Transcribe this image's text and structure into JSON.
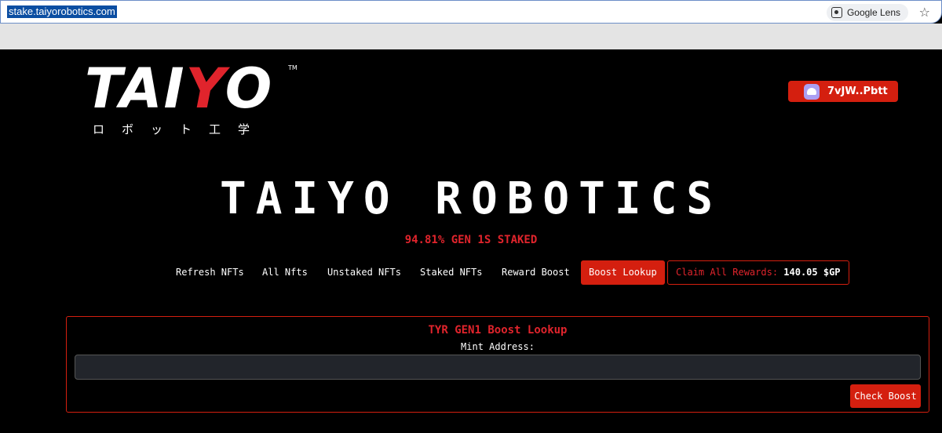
{
  "browser": {
    "url": "stake.taiyorobotics.com",
    "lens_label": "Google Lens",
    "star_glyph": "☆"
  },
  "logo": {
    "part1": "TAI",
    "part2": "Y",
    "part3": "O",
    "tm": "TM",
    "japanese": "ロボット工学"
  },
  "wallet": {
    "label": "7vJW..Pbtt",
    "icon": "phantom-ghost-icon"
  },
  "hero": {
    "title": "TAIYO ROBOTICS",
    "staked": "94.81% GEN 1S STAKED"
  },
  "nav": {
    "items": [
      "Refresh NFTs",
      "All Nfts",
      "Unstaked NFTs",
      "Staked NFTs",
      "Reward Boost",
      "Boost Lookup"
    ],
    "claim_label": "Claim All Rewards:",
    "claim_value": "140.05 $GP"
  },
  "lookup": {
    "title": "TYR GEN1 Boost Lookup",
    "mint_label": "Mint Address:",
    "mint_value": "",
    "button": "Check Boost"
  },
  "colors": {
    "accent": "#d41f0f",
    "accent_text": "#e0242c",
    "background": "#000000"
  }
}
